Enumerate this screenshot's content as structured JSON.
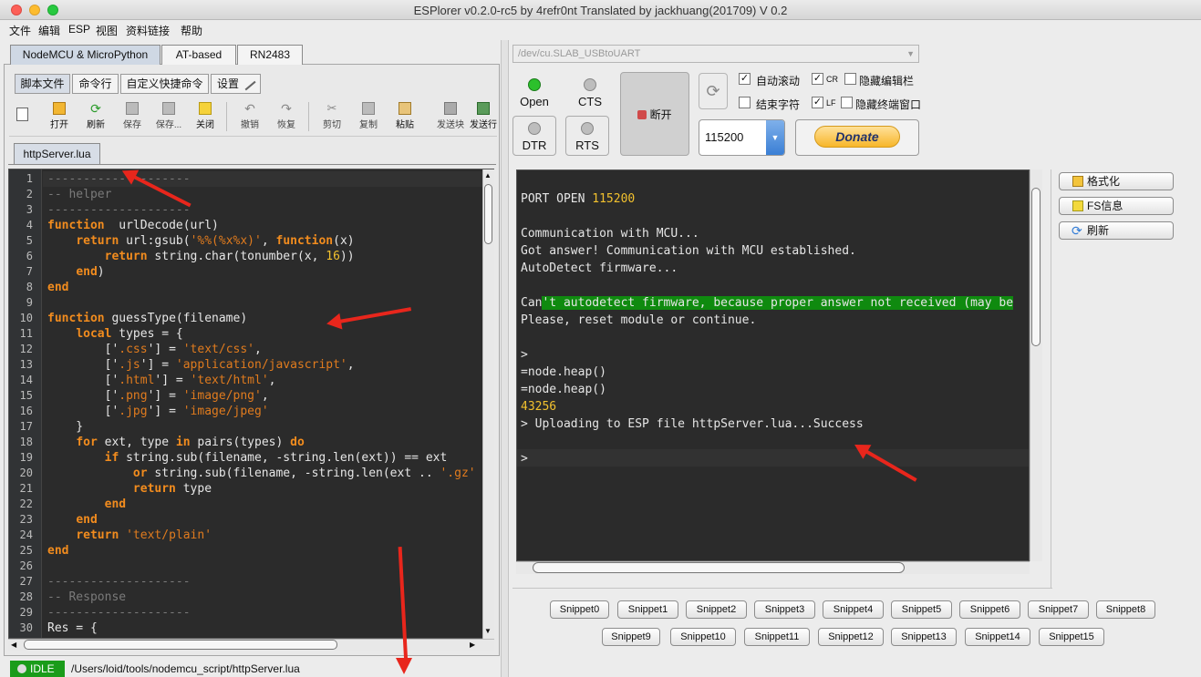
{
  "window": {
    "title": "ESPlorer v0.2.0-rc5 by 4refr0nt Translated by jackhuang(201709) V 0.2"
  },
  "menu": [
    "文件",
    "编辑",
    "ESP",
    "视图",
    "资料链接",
    "帮助"
  ],
  "left": {
    "main_tabs": [
      "NodeMCU & MicroPython",
      "AT-based",
      "RN2483"
    ],
    "sub_tabs": [
      "脚本文件",
      "命令行",
      "自定义快捷命令",
      "设置"
    ],
    "toolbar": [
      "打开",
      "刷新",
      "保存",
      "保存...",
      "关闭",
      "撤销",
      "恢复",
      "剪切",
      "复制",
      "粘贴",
      "发送块",
      "发送行"
    ],
    "file_tab": "httpServer.lua",
    "code": [
      [
        [
          "cm",
          "--------------------"
        ]
      ],
      [
        [
          "cm",
          "-- helper"
        ]
      ],
      [
        [
          "cm",
          "--------------------"
        ]
      ],
      [
        [
          "kw",
          "function"
        ],
        [
          "",
          "  urlDecode(url)"
        ]
      ],
      [
        [
          "",
          "    "
        ],
        [
          "kw",
          "return"
        ],
        [
          "",
          " url:gsub("
        ],
        [
          "st",
          "'%%(%x%x)'"
        ],
        [
          "",
          ", "
        ],
        [
          "kw",
          "function"
        ],
        [
          "",
          "(x)"
        ]
      ],
      [
        [
          "",
          "        "
        ],
        [
          "kw",
          "return"
        ],
        [
          "",
          " string.char(tonumber(x, "
        ],
        [
          "nu",
          "16"
        ],
        [
          "",
          "))"
        ]
      ],
      [
        [
          "",
          "    "
        ],
        [
          "kw",
          "end"
        ],
        [
          "",
          ")"
        ]
      ],
      [
        [
          "kw",
          "end"
        ]
      ],
      [
        [
          "",
          ""
        ]
      ],
      [
        [
          "kw",
          "function"
        ],
        [
          "",
          " guessType(filename)"
        ]
      ],
      [
        [
          "",
          "    "
        ],
        [
          "kw",
          "local"
        ],
        [
          "",
          " types = {"
        ]
      ],
      [
        [
          "",
          "        ['"
        ],
        [
          "st",
          ".css"
        ],
        [
          "",
          "'] = "
        ],
        [
          "st",
          "'text/css'"
        ],
        [
          "",
          ","
        ]
      ],
      [
        [
          "",
          "        ['"
        ],
        [
          "st",
          ".js"
        ],
        [
          "",
          "'] = "
        ],
        [
          "st",
          "'application/javascript'"
        ],
        [
          "",
          ","
        ]
      ],
      [
        [
          "",
          "        ['"
        ],
        [
          "st",
          ".html"
        ],
        [
          "",
          "'] = "
        ],
        [
          "st",
          "'text/html'"
        ],
        [
          "",
          ","
        ]
      ],
      [
        [
          "",
          "        ['"
        ],
        [
          "st",
          ".png"
        ],
        [
          "",
          "'] = "
        ],
        [
          "st",
          "'image/png'"
        ],
        [
          "",
          ","
        ]
      ],
      [
        [
          "",
          "        ['"
        ],
        [
          "st",
          ".jpg"
        ],
        [
          "",
          "'] = "
        ],
        [
          "st",
          "'image/jpeg'"
        ]
      ],
      [
        [
          "",
          "    }"
        ]
      ],
      [
        [
          "",
          "    "
        ],
        [
          "kw",
          "for"
        ],
        [
          "",
          " ext, type "
        ],
        [
          "kw",
          "in"
        ],
        [
          "",
          " pairs(types) "
        ],
        [
          "kw",
          "do"
        ]
      ],
      [
        [
          "",
          "        "
        ],
        [
          "kw",
          "if"
        ],
        [
          "",
          " string.sub(filename, -string.len(ext)) == ext"
        ]
      ],
      [
        [
          "",
          "            "
        ],
        [
          "kw",
          "or"
        ],
        [
          "",
          " string.sub(filename, -string.len(ext .. "
        ],
        [
          "st",
          "'.gz'"
        ]
      ],
      [
        [
          "",
          "            "
        ],
        [
          "kw",
          "return"
        ],
        [
          "",
          " type"
        ]
      ],
      [
        [
          "",
          "        "
        ],
        [
          "kw",
          "end"
        ]
      ],
      [
        [
          "",
          "    "
        ],
        [
          "kw",
          "end"
        ]
      ],
      [
        [
          "",
          "    "
        ],
        [
          "kw",
          "return"
        ],
        [
          "",
          " "
        ],
        [
          "st",
          "'text/plain'"
        ]
      ],
      [
        [
          "kw",
          "end"
        ]
      ],
      [
        [
          "",
          ""
        ]
      ],
      [
        [
          "cm",
          "--------------------"
        ]
      ],
      [
        [
          "cm",
          "-- Response"
        ]
      ],
      [
        [
          "cm",
          "--------------------"
        ]
      ],
      [
        [
          "",
          "Res = {"
        ]
      ]
    ],
    "status": {
      "state": "IDLE",
      "path": "/Users/loid/tools/nodemcu_script/httpServer.lua"
    }
  },
  "right": {
    "port": "/dev/cu.SLAB_USBtoUART",
    "leds": {
      "open": "Open",
      "cts": "CTS",
      "dtr": "DTR",
      "rts": "RTS"
    },
    "disconnect": "断开",
    "checks": {
      "autoscroll": "自动滚动",
      "cr": "CR",
      "hide_editor": "隐藏编辑栏",
      "end_char": "结束字符",
      "lf": "LF",
      "hide_terminal": "隐藏终端窗口"
    },
    "baud": "115200",
    "donate": "Donate",
    "side_buttons": [
      "格式化",
      "FS信息",
      "刷新"
    ],
    "terminal": [
      "",
      "PORT OPEN |115200",
      "",
      "Communication with MCU...",
      "Got answer! Communication with MCU established.",
      "AutoDetect firmware...",
      "",
      "Can|'t autodetect firmware, because proper answer not received (may be",
      "Please, reset module or continue.",
      "",
      ">",
      "=node.heap()",
      "=node.heap()",
      "43256",
      "> Uploading to ESP file httpServer.lua...Success",
      "",
      ">"
    ],
    "snippets_row1": [
      "Snippet0",
      "Snippet1",
      "Snippet2",
      "Snippet3",
      "Snippet4",
      "Snippet5",
      "Snippet6",
      "Snippet7",
      "Snippet8"
    ],
    "snippets_row2": [
      "Snippet9",
      "Snippet10",
      "Snippet11",
      "Snippet12",
      "Snippet13",
      "Snippet14",
      "Snippet15"
    ]
  }
}
